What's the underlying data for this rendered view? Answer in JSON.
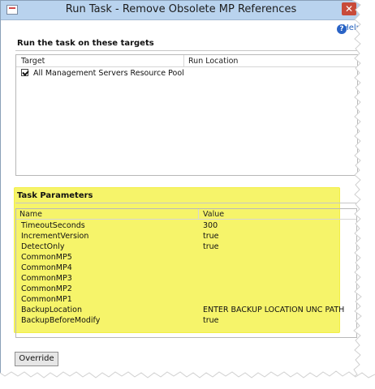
{
  "window": {
    "title": "Run Task - Remove Obsolete MP References",
    "close_label": "✕",
    "help_label": "Help"
  },
  "targets_section": {
    "heading": "Run the task on these targets",
    "columns": [
      "Target",
      "Run Location"
    ],
    "rows": [
      {
        "target": "All Management Servers Resource Pool",
        "checked": true,
        "run_location": ""
      }
    ]
  },
  "task_parameters": {
    "heading": "Task Parameters",
    "columns": [
      "Name",
      "Value"
    ],
    "rows": [
      {
        "name": "TimeoutSeconds",
        "value": "300"
      },
      {
        "name": "IncrementVersion",
        "value": "true"
      },
      {
        "name": "DetectOnly",
        "value": "true"
      },
      {
        "name": "CommonMP5",
        "value": ""
      },
      {
        "name": "CommonMP4",
        "value": ""
      },
      {
        "name": "CommonMP3",
        "value": ""
      },
      {
        "name": "CommonMP2",
        "value": ""
      },
      {
        "name": "CommonMP1",
        "value": ""
      },
      {
        "name": "BackupLocation",
        "value": "ENTER BACKUP LOCATION UNC PATH"
      },
      {
        "name": "BackupBeforeModify",
        "value": "true"
      }
    ]
  },
  "actions": {
    "override_label": "Override"
  },
  "colors": {
    "highlight": "#f6f46a",
    "titlebar": "#b9d3ee",
    "close_button": "#c84b3a"
  },
  "icons": {
    "title_icon": "window-icon",
    "help_icon": "help-circle-icon",
    "close_icon": "close-icon",
    "checkbox_icon": "checkbox-checked-icon"
  }
}
